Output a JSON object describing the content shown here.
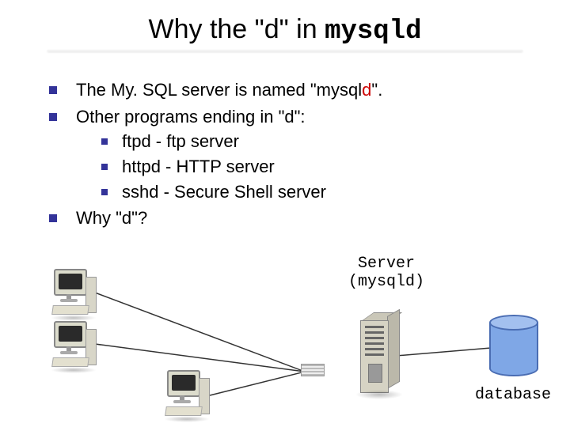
{
  "title": {
    "prefix": "Why the \"d\" in ",
    "mono": "mysqld"
  },
  "bullets": {
    "b1": {
      "pre": "The My. SQL server is named \"mysql",
      "d": "d",
      "post": "\"."
    },
    "b2": "Other programs ending in \"d\":",
    "sub": {
      "s1": "ftpd - ftp server",
      "s2": "httpd - HTTP server",
      "s3": "sshd - Secure Shell server"
    },
    "b3": "Why \"d\"?"
  },
  "diagram": {
    "server_label_line1": "Server",
    "server_label_line2_open": "(",
    "server_label_line2_mono": "mysqld",
    "server_label_line2_close": ")",
    "db_label": "database"
  }
}
